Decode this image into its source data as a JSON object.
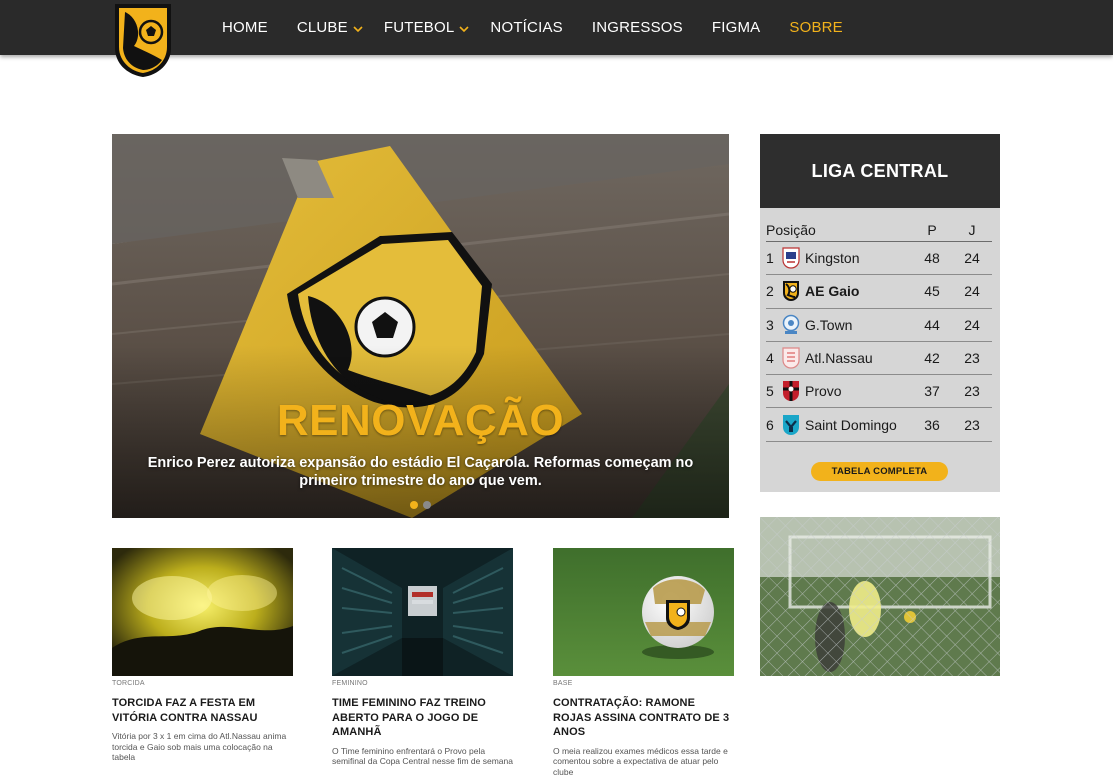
{
  "nav": {
    "items": [
      {
        "label": "HOME",
        "dropdown": false,
        "active": false
      },
      {
        "label": "CLUBE",
        "dropdown": true,
        "active": false
      },
      {
        "label": "FUTEBOL",
        "dropdown": true,
        "active": false
      },
      {
        "label": "NOTÍCIAS",
        "dropdown": false,
        "active": false
      },
      {
        "label": "INGRESSOS",
        "dropdown": false,
        "active": false
      },
      {
        "label": "FIGMA",
        "dropdown": false,
        "active": false
      },
      {
        "label": "SOBRE",
        "dropdown": false,
        "active": true
      }
    ]
  },
  "hero": {
    "title": "RENOVAÇÃO",
    "subtitle": "Enrico Perez autoriza expansão do estádio El Caçarola. Reformas começam no primeiro trimestre do ano que vem.",
    "slides": 2,
    "active_slide": 1
  },
  "league": {
    "title": "LIGA CENTRAL",
    "headers": {
      "position": "Posição",
      "points": "P",
      "games": "J"
    },
    "rows": [
      {
        "pos": "1",
        "team": "Kingston",
        "points": "48",
        "games": "24",
        "crest": "kingston-crest-icon",
        "highlight": false
      },
      {
        "pos": "2",
        "team": "AE Gaio",
        "points": "45",
        "games": "24",
        "crest": "ae-gaio-crest-icon",
        "highlight": true
      },
      {
        "pos": "3",
        "team": "G.Town",
        "points": "44",
        "games": "24",
        "crest": "gtown-crest-icon",
        "highlight": false
      },
      {
        "pos": "4",
        "team": "Atl.Nassau",
        "points": "42",
        "games": "23",
        "crest": "atl-nassau-crest-icon",
        "highlight": false
      },
      {
        "pos": "5",
        "team": "Provo",
        "points": "37",
        "games": "23",
        "crest": "provo-crest-icon",
        "highlight": false
      },
      {
        "pos": "6",
        "team": "Saint Domingo",
        "points": "36",
        "games": "23",
        "crest": "saint-domingo-crest-icon",
        "highlight": false
      }
    ],
    "button_label": "TABELA COMPLETA"
  },
  "news": [
    {
      "category": "TORCIDA",
      "headline": "TORCIDA FAZ A FESTA EM VITÓRIA CONTRA NASSAU",
      "description": "Vitória por 3 x 1 em cima do Atl.Nassau anima torcida e Gaio sob mais uma colocação na tabela"
    },
    {
      "category": "FEMININO",
      "headline": "TIME FEMININO FAZ TREINO ABERTO PARA O JOGO DE AMANHÃ",
      "description": "O Time feminino enfrentará o Provo pela semifinal da Copa Central nesse fim de semana"
    },
    {
      "category": "BASE",
      "headline": "CONTRATAÇÃO: RAMONE ROJAS ASSINA CONTRATO DE 3 ANOS",
      "description": "O meia realizou exames médicos essa tarde e comentou sobre a expectativa de atuar pelo clube"
    }
  ],
  "colors": {
    "accent": "#f2b21b",
    "nav_bg": "#2a2a2a",
    "table_bg": "#d6d6d6",
    "table_head": "#2e2e2e"
  }
}
